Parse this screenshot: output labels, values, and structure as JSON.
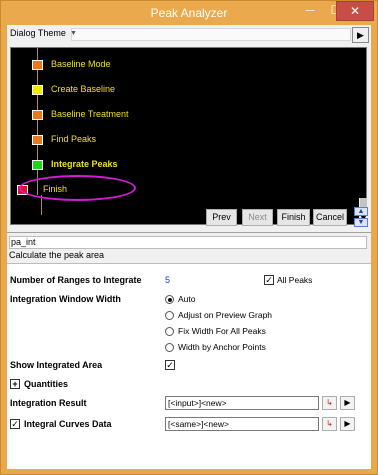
{
  "window": {
    "title": "Peak Analyzer",
    "min_glyph": "─",
    "max_glyph": "☐",
    "close_glyph": "✕"
  },
  "theme": {
    "label": "Dialog Theme",
    "value": "",
    "dropdown_glyph": "▼",
    "button_glyph": "▶"
  },
  "flow": {
    "steps": [
      {
        "label": "Baseline Mode",
        "color": "#e87722"
      },
      {
        "label": "Create Baseline",
        "color": "#f2ea00"
      },
      {
        "label": "Baseline Treatment",
        "color": "#e87722"
      },
      {
        "label": "Find Peaks",
        "color": "#e87722"
      },
      {
        "label": "Integrate Peaks",
        "color": "#1bd61b"
      },
      {
        "label": "Finish",
        "color": "#e8101a"
      }
    ],
    "highlight_color": "#d21bd9",
    "scroll_down_glyph": "▼"
  },
  "nav": {
    "prev": "Prev",
    "next": "Next",
    "finish": "Finish",
    "cancel": "Cancel",
    "up_glyph": "▲",
    "down_glyph": "▼"
  },
  "page": {
    "id": "pa_int",
    "description": "Calculate the peak area"
  },
  "form": {
    "ranges_label": "Number of Ranges to Integrate",
    "ranges_value": "5",
    "all_peaks_label": "All Peaks",
    "all_peaks_checked": "✓",
    "window_width_label": "Integration Window Width",
    "width_options": [
      "Auto",
      "Adjust on Preview Graph",
      "Fix Width For All Peaks",
      "Width by Anchor Points"
    ],
    "show_area_label": "Show Integrated Area",
    "show_area_checked": "✓",
    "quantities_label": "Quantities",
    "quantities_glyph": "+",
    "result_label": "Integration Result",
    "result_value": "[<input>]<new>",
    "curves_label": "Integral Curves Data",
    "curves_checked": "✓",
    "curves_value": "[<same>]<new>",
    "menu_glyph": "▶",
    "pick_glyph": "↳"
  }
}
